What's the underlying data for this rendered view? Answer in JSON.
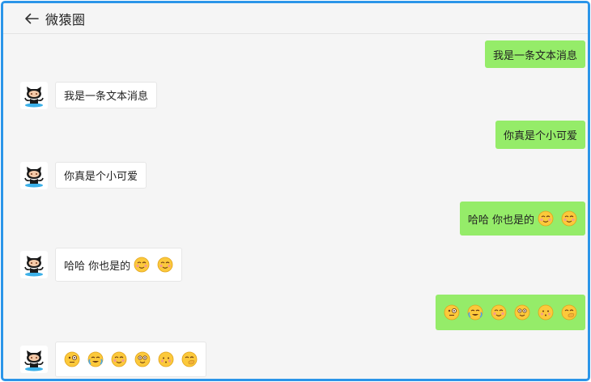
{
  "header": {
    "title": "微猿圈",
    "back_icon": "arrow-left-icon"
  },
  "colors": {
    "border": "#2b95e9",
    "outgoing": "#95ec69",
    "incoming": "#ffffff",
    "background": "#f5f5f5"
  },
  "messages": [
    {
      "dir": "out",
      "text": "我是一条文本消息",
      "emojis": []
    },
    {
      "dir": "in",
      "text": "我是一条文本消息",
      "emojis": []
    },
    {
      "dir": "out",
      "text": "你真是个小可爱",
      "emojis": []
    },
    {
      "dir": "in",
      "text": "你真是个小可爱",
      "emojis": []
    },
    {
      "dir": "out",
      "text": "哈哈 你也是的",
      "emojis": [
        "blushing-face-icon",
        "blushing-face-icon"
      ]
    },
    {
      "dir": "in",
      "text": "哈哈 你也是的",
      "emojis": [
        "blushing-face-icon",
        "blushing-face-icon"
      ]
    },
    {
      "dir": "out",
      "text": "",
      "emojis": [
        "monocle-face-icon",
        "crying-face-icon",
        "blushing-face-icon",
        "star-struck-face-icon",
        "smiling-face-icon",
        "hand-over-mouth-face-icon"
      ]
    },
    {
      "dir": "in",
      "text": "",
      "emojis": [
        "monocle-face-icon",
        "crying-face-icon",
        "blushing-face-icon",
        "star-struck-face-icon",
        "smiling-face-icon",
        "hand-over-mouth-face-icon"
      ]
    }
  ],
  "avatar_icon": "octocat-avatar-icon"
}
